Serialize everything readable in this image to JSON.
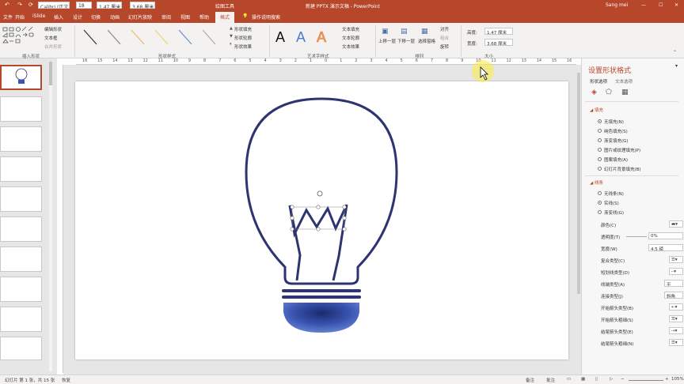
{
  "titlebar": {
    "quick_access": [
      "↶",
      "↷",
      "⟳"
    ],
    "font_name": "Calibri (正文)",
    "font_size": "18",
    "height_box": "1.47 厘米",
    "width_box": "3.68 厘米",
    "context": "绘图工具",
    "doc_title": "新建 PPTX 演示文稿 - PowerPoint",
    "user": "Sang mei"
  },
  "tabs": [
    {
      "label": "文件"
    },
    {
      "label": "开始"
    },
    {
      "label": "iSlide"
    },
    {
      "label": "插入"
    },
    {
      "label": "设计"
    },
    {
      "label": "切换"
    },
    {
      "label": "动画"
    },
    {
      "label": "幻灯片放映"
    },
    {
      "label": "审阅"
    },
    {
      "label": "视图"
    },
    {
      "label": "帮助"
    },
    {
      "label": "格式"
    },
    {
      "label": "操作说明搜索"
    }
  ],
  "ribbon": {
    "insert_shapes": {
      "edit_shape": "编辑形状",
      "text_box": "文本框",
      "merge_shapes": "合并形状",
      "group": "插入形状"
    },
    "shape_styles": {
      "fill": "形状填充",
      "outline": "形状轮廓",
      "effect": "形状效果",
      "group": "形状样式"
    },
    "wordart": {
      "sample": "A",
      "text_fill": "文本填充",
      "text_outline": "文本轮廓",
      "text_effect": "文本效果",
      "group": "艺术字样式"
    },
    "arrange": {
      "bring_forward": "上移一层",
      "send_backward": "下移一层",
      "selection_pane": "选择窗格",
      "align": "对齐",
      "group_btn": "组合",
      "rotate": "旋转",
      "group": "排列"
    },
    "size": {
      "height_label": "高度:",
      "height": "1.47 厘米",
      "width_label": "宽度:",
      "width": "3.68 厘米",
      "group": "大小"
    }
  },
  "ruler_labels": [
    "16",
    "15",
    "14",
    "13",
    "12",
    "11",
    "10",
    "9",
    "8",
    "7",
    "6",
    "5",
    "4",
    "3",
    "2",
    "1",
    "0",
    "1",
    "2",
    "3",
    "4",
    "5",
    "6",
    "7",
    "8",
    "9",
    "10",
    "11",
    "12",
    "13",
    "14",
    "15",
    "16"
  ],
  "slides": [
    {
      "num": "1"
    },
    {
      "num": "2"
    },
    {
      "num": "3"
    },
    {
      "num": "4"
    },
    {
      "num": "5"
    },
    {
      "num": "6"
    },
    {
      "num": "7"
    },
    {
      "num": "8"
    },
    {
      "num": "9"
    }
  ],
  "pane": {
    "title": "设置形状格式",
    "tab1": "形状选项",
    "tab2": "文本选项",
    "fill_header": "填充",
    "fill_options": [
      {
        "label": "无填充(N)",
        "on": true
      },
      {
        "label": "纯色填充(S)",
        "on": false
      },
      {
        "label": "渐变填充(G)",
        "on": false
      },
      {
        "label": "图片或纹理填充(P)",
        "on": false
      },
      {
        "label": "图案填充(A)",
        "on": false
      },
      {
        "label": "幻灯片背景填充(B)",
        "on": false
      }
    ],
    "line_header": "线条",
    "line_options": [
      {
        "label": "无线条(N)",
        "on": false
      },
      {
        "label": "实线(S)",
        "on": true
      },
      {
        "label": "渐变线(G)",
        "on": false
      }
    ],
    "props": [
      {
        "label": "颜色(C)",
        "val": ""
      },
      {
        "label": "透明度(T)",
        "val": "0%"
      },
      {
        "label": "宽度(W)",
        "val": "4.5 磅"
      },
      {
        "label": "复合类型(C)",
        "val": ""
      },
      {
        "label": "短划线类型(D)",
        "val": ""
      },
      {
        "label": "线端类型(A)",
        "val": "平"
      },
      {
        "label": "连接类型(J)",
        "val": "斜角"
      },
      {
        "label": "开始箭头类型(B)",
        "val": ""
      },
      {
        "label": "开始箭头粗细(S)",
        "val": ""
      },
      {
        "label": "结尾箭头类型(E)",
        "val": ""
      },
      {
        "label": "结尾箭头粗细(N)",
        "val": ""
      }
    ]
  },
  "status": {
    "slide_info": "幻灯片 第 1 张，共 15 张",
    "restore": "恢复",
    "notes": "备注",
    "comments": "批注",
    "zoom": "105%"
  },
  "colors": {
    "accent": "#b7472a",
    "bulb_line": "#2e3470",
    "bulb_fill": "#3a55b0"
  }
}
